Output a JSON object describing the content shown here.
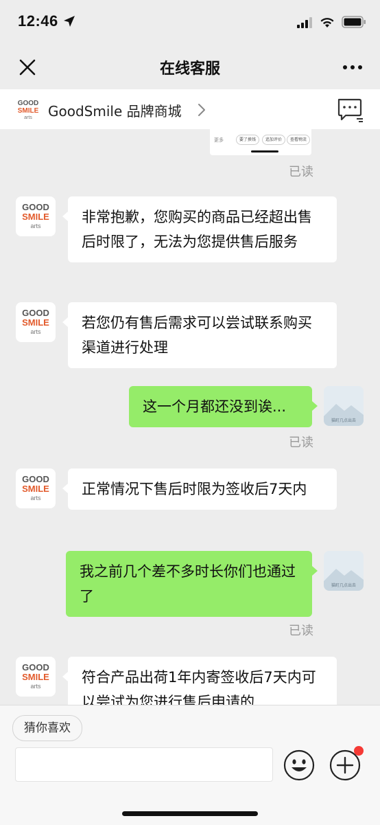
{
  "status_bar": {
    "time": "12:46"
  },
  "nav": {
    "title": "在线客服"
  },
  "merchant": {
    "name": "GoodSmile 品牌商城",
    "logo_line1": "GOOD",
    "logo_line2": "SMILE",
    "logo_line3": "arts"
  },
  "card_fragment": {
    "label": "更多",
    "buttons": [
      "要了换钱",
      "追加评价",
      "查看物流"
    ]
  },
  "messages": [
    {
      "side": "left",
      "text": "非常抱歉，您购买的商品已经超出售后时限了，无法为您提供售后服务"
    },
    {
      "side": "left",
      "text": "若您仍有售后需求可以尝试联系购买渠道进行处理"
    },
    {
      "side": "right",
      "text": "这一个月都还没到诶...",
      "read": "已读"
    },
    {
      "side": "left",
      "text": "正常情况下售后时限为签收后7天内"
    },
    {
      "side": "right",
      "text": "我之前几个差不多时长你们也通过了",
      "read": "已读"
    },
    {
      "side": "left",
      "text": "符合产品出荷1年内寄签收后7天内可以尝试为您进行售后申请的"
    }
  ],
  "read_label": "已读",
  "user_avatar_caption": "猫町几点出去",
  "bottom": {
    "suggest_chip": "猜你喜欢",
    "input_value": ""
  },
  "colors": {
    "background": "#ededed",
    "sent_bubble": "#95ec69",
    "received_bubble": "#ffffff",
    "badge": "#f53a35"
  }
}
